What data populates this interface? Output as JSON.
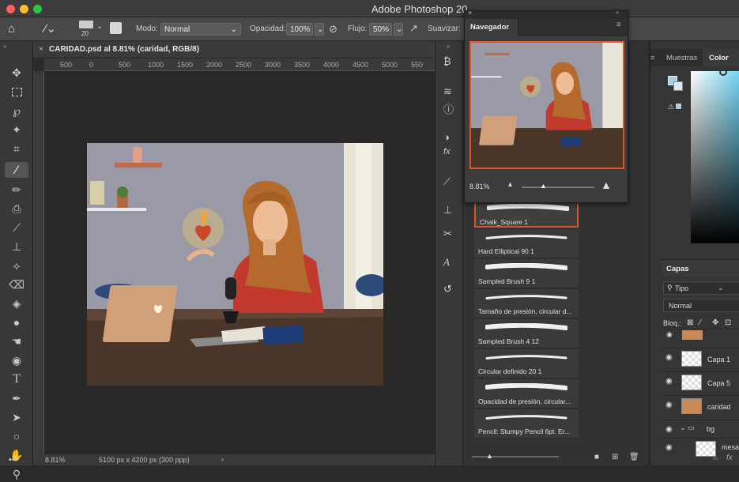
{
  "window": {
    "title": "Adobe Photoshop 20"
  },
  "options_bar": {
    "brush_size": "20",
    "mode_label": "Modo:",
    "mode_value": "Normal",
    "opacity_label": "Opacidad:",
    "opacity_value": "100%",
    "flow_label": "Flujo:",
    "flow_value": "50%",
    "smoothing_label": "Suavizar:"
  },
  "document": {
    "tab_label": "CARIDAD.psd al 8.81% (caridad, RGB/8)",
    "ruler_marks": [
      "500",
      "0",
      "500",
      "1000",
      "1500",
      "2000",
      "2500",
      "3000",
      "3500",
      "4000",
      "4500",
      "5000",
      "550"
    ],
    "zoom": "8.81%",
    "size_info": "5100 px x 4200 px (300 ppp)"
  },
  "navigator": {
    "title": "Navegador",
    "zoom": "8.81%"
  },
  "brushes": [
    "Chalk_Square 1",
    "Hard Elliptical 90 1",
    "Sampled Brush 9 1",
    "Tamaño de presión, circular d...",
    "Sampled Brush 4 12",
    "Circular definido 20 1",
    "Opacidad de presión, circular...",
    "Pencil: Stumpy Pencil 6pt. Er..."
  ],
  "color_panel": {
    "tab_swatches": "Muestras",
    "tab_color": "Color"
  },
  "layers_panel": {
    "title": "Capas",
    "filter": "Tipo",
    "blend_mode": "Normal",
    "lock_label": "Bloq.:",
    "layers": [
      {
        "name": "Capa 1"
      },
      {
        "name": "Capa 5"
      },
      {
        "name": "caridad"
      },
      {
        "name": "bg"
      },
      {
        "name": "mesa"
      }
    ]
  },
  "colors": {
    "accent": "#e0542a",
    "wall": "#9b9aa8",
    "table": "#5a4030"
  }
}
